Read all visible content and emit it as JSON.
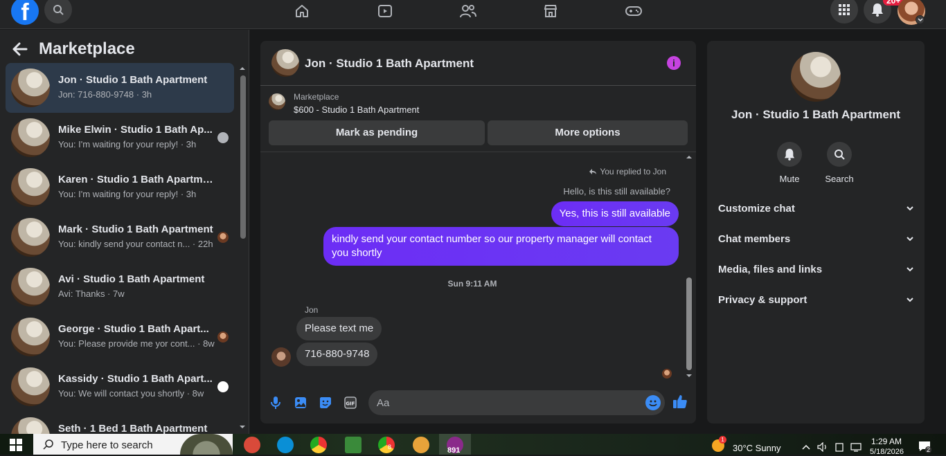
{
  "topbar": {
    "logo_letter": "f",
    "notification_count": "20+"
  },
  "sidebar": {
    "title": "Marketplace",
    "conversations": [
      {
        "name": "Jon · Studio 1 Bath Apartment",
        "preview": "Jon: 716-880-9748 · 3h"
      },
      {
        "name": "Mike Elwin · Studio 1 Bath Ap...",
        "preview": "You: I'm waiting for your reply! · 3h"
      },
      {
        "name": "Karen · Studio 1 Bath Apartment",
        "preview": "You: I'm waiting for your reply! · 3h"
      },
      {
        "name": "Mark · Studio 1 Bath Apartment",
        "preview": "You: kindly send your contact n... · 22h"
      },
      {
        "name": "Avi · Studio 1 Bath Apartment",
        "preview": "Avi: Thanks · 7w"
      },
      {
        "name": "George · Studio 1 Bath Apart...",
        "preview": "You: Please provide me yor cont... · 8w"
      },
      {
        "name": "Kassidy · Studio 1 Bath Apart...",
        "preview": "You: We will contact you shortly · 8w"
      },
      {
        "name": "Seth · 1 Bed 1 Bath Apartment",
        "preview": ""
      }
    ]
  },
  "chat": {
    "title": "Jon · Studio 1 Bath Apartment",
    "listing_category": "Marketplace",
    "listing_name": "$600 - Studio 1 Bath Apartment",
    "mark_pending_label": "Mark as pending",
    "more_options_label": "More options",
    "replied_note": "You replied to Jon",
    "replied_quote": "Hello, is this still available?",
    "out_msg_1": "Yes, this is still available",
    "out_msg_2": "kindly send your contact number so our property manager will contact you shortly",
    "timestamp": "Sun 9:11 AM",
    "sender_name": "Jon",
    "in_msg_1": "Please text me",
    "in_msg_2": "716-880-9748",
    "composer_placeholder": "Aa"
  },
  "info_panel": {
    "name": "Jon · Studio 1 Bath Apartment",
    "mute_label": "Mute",
    "search_label": "Search",
    "sections": [
      "Customize chat",
      "Chat members",
      "Media, files and links",
      "Privacy & support"
    ]
  },
  "taskbar": {
    "search_placeholder": "Type here to search",
    "app_badge": "891",
    "chrome_badge": "8",
    "weather": "30°C  Sunny",
    "weather_badge": "1",
    "time": "1:29 AM",
    "date": "5/18/2026",
    "notification_count": "2"
  },
  "colors": {
    "accent": "#1877f2",
    "outgoing_bubble": "#6a3bf2",
    "info_icon": "#c643e0",
    "panel_bg": "#242526"
  }
}
